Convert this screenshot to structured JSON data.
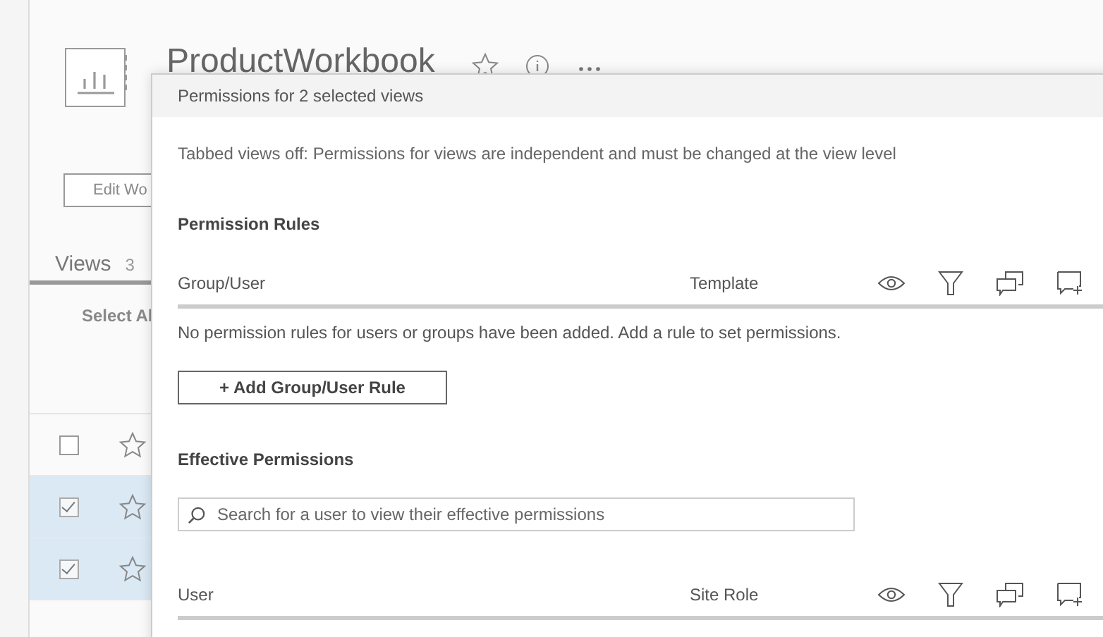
{
  "workbook": {
    "title": "ProductWorkbook",
    "edit_button": "Edit Wo"
  },
  "tabs": [
    {
      "label": "Views",
      "count": "3",
      "selected": true
    }
  ],
  "select_all": "Select Al",
  "view_rows": [
    {
      "checked": false,
      "selected": false
    },
    {
      "checked": true,
      "selected": true
    },
    {
      "checked": true,
      "selected": true
    }
  ],
  "dialog": {
    "title": "Permissions for 2 selected views",
    "note": "Tabbed views off: Permissions for views are independent and must be changed at the view level",
    "rules": {
      "heading": "Permission Rules",
      "columns": [
        "Group/User",
        "Template"
      ],
      "empty_text": "No permission rules for users or groups have been added. Add a rule to set permissions.",
      "add_button": "+ Add Group/User Rule"
    },
    "effective": {
      "heading": "Effective Permissions",
      "search": {
        "placeholder": "Search for a user to view their effective permissions"
      },
      "columns": [
        "User",
        "Site Role"
      ]
    }
  }
}
